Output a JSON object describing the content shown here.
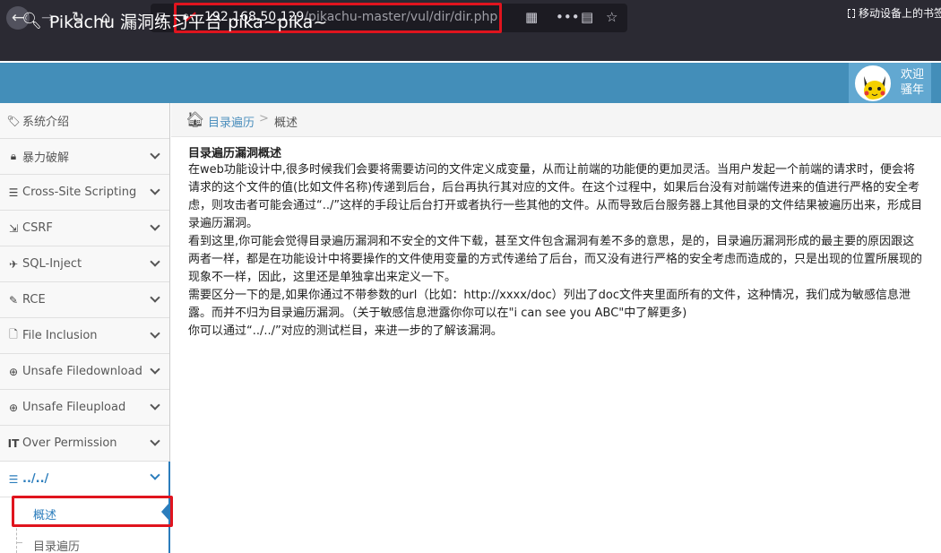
{
  "browser": {
    "url_host": "192.168.50.129",
    "url_path": "/pikachu-master/vul/dir/dir.php",
    "bookmark_label": "移动设备上的书签"
  },
  "header": {
    "brand_title": "Pikachu 漏洞练习平台 pika~pika~",
    "welcome": "欢迎",
    "user_name": "骚年"
  },
  "sidebar": {
    "items": [
      {
        "label": "系统介绍",
        "icon": "tag-icon"
      },
      {
        "label": "暴力破解",
        "icon": "lock-icon"
      },
      {
        "label": "Cross-Site Scripting",
        "icon": "list-icon"
      },
      {
        "label": "CSRF",
        "icon": "share-icon"
      },
      {
        "label": "SQL-Inject",
        "icon": "plane-icon"
      },
      {
        "label": "RCE",
        "icon": "pencil-icon"
      },
      {
        "label": "File Inclusion",
        "icon": "file-icon"
      },
      {
        "label": "Unsafe Filedownload",
        "icon": "download-icon"
      },
      {
        "label": "Unsafe Fileupload",
        "icon": "upload-icon"
      },
      {
        "label": "Over Permission",
        "icon": "text-cursor-icon"
      },
      {
        "label": "../../",
        "icon": "list-icon"
      }
    ],
    "sub_items": [
      {
        "label": "概述"
      },
      {
        "label": "目录遍历"
      }
    ]
  },
  "breadcrumb": {
    "link": "目录遍历",
    "separator": ">",
    "current": "概述"
  },
  "content": {
    "heading": "目录遍历漏洞概述",
    "para1": "在web功能设计中,很多时候我们会要将需要访问的文件定义成变量，从而让前端的功能便的更加灵活。当用户发起一个前端的请求时，便会将请求的这个文件的值(比如文件名称)传递到后台，后台再执行其对应的文件。在这个过程中，如果后台没有对前端传进来的值进行严格的安全考虑，则攻击者可能会通过“../”这样的手段让后台打开或者执行一些其他的文件。从而导致后台服务器上其他目录的文件结果被遍历出来，形成目录遍历漏洞。",
    "para2": "看到这里,你可能会觉得目录遍历漏洞和不安全的文件下载，甚至文件包含漏洞有差不多的意思，是的，目录遍历漏洞形成的最主要的原因跟这两者一样，都是在功能设计中将要操作的文件使用变量的方式传递给了后台，而又没有进行严格的安全考虑而造成的，只是出现的位置所展现的现象不一样，因此，这里还是单独拿出来定义一下。",
    "para3": "需要区分一下的是,如果你通过不带参数的url（比如：http://xxxx/doc）列出了doc文件夹里面所有的文件，这种情况，我们成为敏感信息泄露。而并不归为目录遍历漏洞。（关于敏感信息泄露你你可以在\"i can see you ABC\"中了解更多)",
    "para4": "你可以通过“../../”对应的测试栏目，来进一步的了解该漏洞。"
  }
}
